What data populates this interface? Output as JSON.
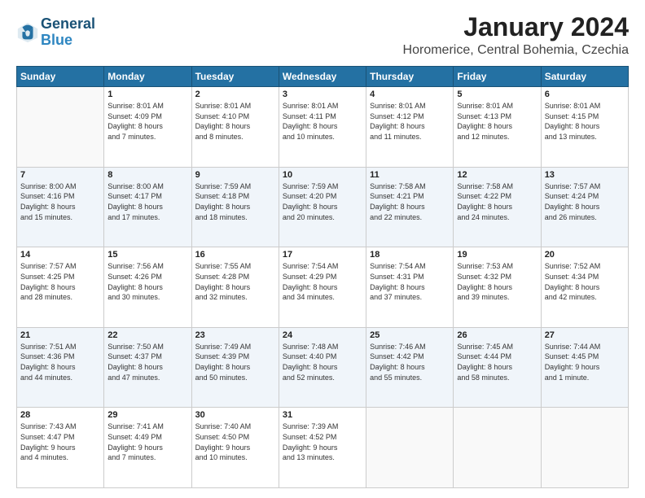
{
  "logo": {
    "line1": "General",
    "line2": "Blue"
  },
  "title": "January 2024",
  "location": "Horomerice, Central Bohemia, Czechia",
  "days_header": [
    "Sunday",
    "Monday",
    "Tuesday",
    "Wednesday",
    "Thursday",
    "Friday",
    "Saturday"
  ],
  "weeks": [
    [
      {
        "day": "",
        "info": ""
      },
      {
        "day": "1",
        "info": "Sunrise: 8:01 AM\nSunset: 4:09 PM\nDaylight: 8 hours\nand 7 minutes."
      },
      {
        "day": "2",
        "info": "Sunrise: 8:01 AM\nSunset: 4:10 PM\nDaylight: 8 hours\nand 8 minutes."
      },
      {
        "day": "3",
        "info": "Sunrise: 8:01 AM\nSunset: 4:11 PM\nDaylight: 8 hours\nand 10 minutes."
      },
      {
        "day": "4",
        "info": "Sunrise: 8:01 AM\nSunset: 4:12 PM\nDaylight: 8 hours\nand 11 minutes."
      },
      {
        "day": "5",
        "info": "Sunrise: 8:01 AM\nSunset: 4:13 PM\nDaylight: 8 hours\nand 12 minutes."
      },
      {
        "day": "6",
        "info": "Sunrise: 8:01 AM\nSunset: 4:15 PM\nDaylight: 8 hours\nand 13 minutes."
      }
    ],
    [
      {
        "day": "7",
        "info": "Sunrise: 8:00 AM\nSunset: 4:16 PM\nDaylight: 8 hours\nand 15 minutes."
      },
      {
        "day": "8",
        "info": "Sunrise: 8:00 AM\nSunset: 4:17 PM\nDaylight: 8 hours\nand 17 minutes."
      },
      {
        "day": "9",
        "info": "Sunrise: 7:59 AM\nSunset: 4:18 PM\nDaylight: 8 hours\nand 18 minutes."
      },
      {
        "day": "10",
        "info": "Sunrise: 7:59 AM\nSunset: 4:20 PM\nDaylight: 8 hours\nand 20 minutes."
      },
      {
        "day": "11",
        "info": "Sunrise: 7:58 AM\nSunset: 4:21 PM\nDaylight: 8 hours\nand 22 minutes."
      },
      {
        "day": "12",
        "info": "Sunrise: 7:58 AM\nSunset: 4:22 PM\nDaylight: 8 hours\nand 24 minutes."
      },
      {
        "day": "13",
        "info": "Sunrise: 7:57 AM\nSunset: 4:24 PM\nDaylight: 8 hours\nand 26 minutes."
      }
    ],
    [
      {
        "day": "14",
        "info": "Sunrise: 7:57 AM\nSunset: 4:25 PM\nDaylight: 8 hours\nand 28 minutes."
      },
      {
        "day": "15",
        "info": "Sunrise: 7:56 AM\nSunset: 4:26 PM\nDaylight: 8 hours\nand 30 minutes."
      },
      {
        "day": "16",
        "info": "Sunrise: 7:55 AM\nSunset: 4:28 PM\nDaylight: 8 hours\nand 32 minutes."
      },
      {
        "day": "17",
        "info": "Sunrise: 7:54 AM\nSunset: 4:29 PM\nDaylight: 8 hours\nand 34 minutes."
      },
      {
        "day": "18",
        "info": "Sunrise: 7:54 AM\nSunset: 4:31 PM\nDaylight: 8 hours\nand 37 minutes."
      },
      {
        "day": "19",
        "info": "Sunrise: 7:53 AM\nSunset: 4:32 PM\nDaylight: 8 hours\nand 39 minutes."
      },
      {
        "day": "20",
        "info": "Sunrise: 7:52 AM\nSunset: 4:34 PM\nDaylight: 8 hours\nand 42 minutes."
      }
    ],
    [
      {
        "day": "21",
        "info": "Sunrise: 7:51 AM\nSunset: 4:36 PM\nDaylight: 8 hours\nand 44 minutes."
      },
      {
        "day": "22",
        "info": "Sunrise: 7:50 AM\nSunset: 4:37 PM\nDaylight: 8 hours\nand 47 minutes."
      },
      {
        "day": "23",
        "info": "Sunrise: 7:49 AM\nSunset: 4:39 PM\nDaylight: 8 hours\nand 50 minutes."
      },
      {
        "day": "24",
        "info": "Sunrise: 7:48 AM\nSunset: 4:40 PM\nDaylight: 8 hours\nand 52 minutes."
      },
      {
        "day": "25",
        "info": "Sunrise: 7:46 AM\nSunset: 4:42 PM\nDaylight: 8 hours\nand 55 minutes."
      },
      {
        "day": "26",
        "info": "Sunrise: 7:45 AM\nSunset: 4:44 PM\nDaylight: 8 hours\nand 58 minutes."
      },
      {
        "day": "27",
        "info": "Sunrise: 7:44 AM\nSunset: 4:45 PM\nDaylight: 9 hours\nand 1 minute."
      }
    ],
    [
      {
        "day": "28",
        "info": "Sunrise: 7:43 AM\nSunset: 4:47 PM\nDaylight: 9 hours\nand 4 minutes."
      },
      {
        "day": "29",
        "info": "Sunrise: 7:41 AM\nSunset: 4:49 PM\nDaylight: 9 hours\nand 7 minutes."
      },
      {
        "day": "30",
        "info": "Sunrise: 7:40 AM\nSunset: 4:50 PM\nDaylight: 9 hours\nand 10 minutes."
      },
      {
        "day": "31",
        "info": "Sunrise: 7:39 AM\nSunset: 4:52 PM\nDaylight: 9 hours\nand 13 minutes."
      },
      {
        "day": "",
        "info": ""
      },
      {
        "day": "",
        "info": ""
      },
      {
        "day": "",
        "info": ""
      }
    ]
  ]
}
